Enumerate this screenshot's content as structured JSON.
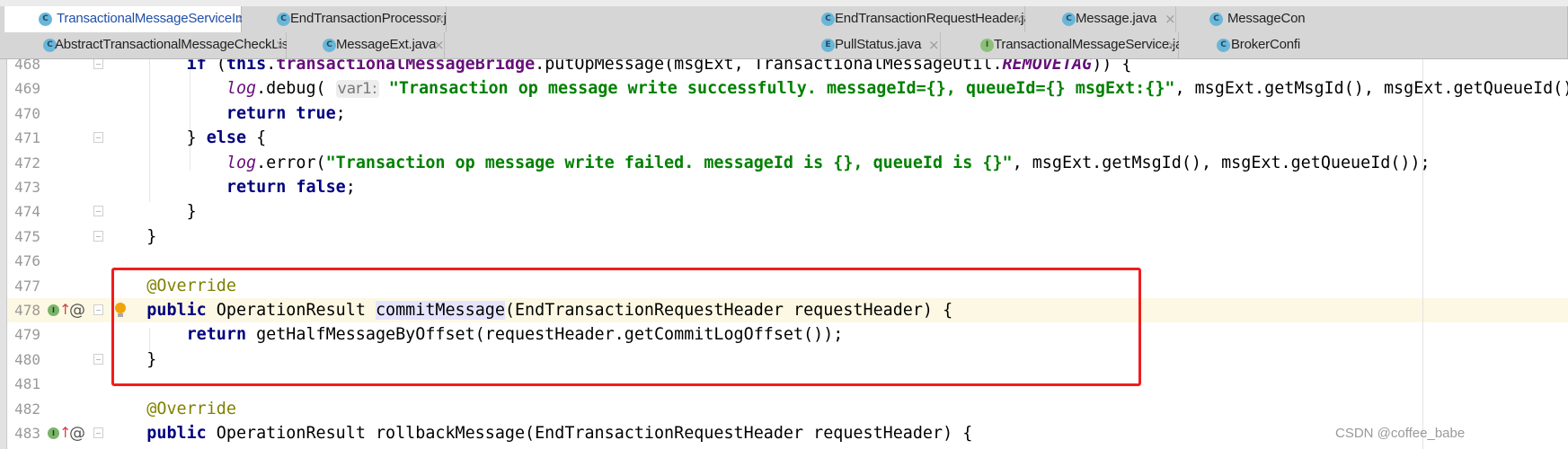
{
  "tabs_row1": [
    {
      "label": "TransactionalMessageServiceImpl.java",
      "icon": "C",
      "active": true
    },
    {
      "label": "EndTransactionProcessor.java",
      "icon": "C"
    },
    {
      "label": "EndTransactionRequestHeader.java",
      "icon": "C"
    },
    {
      "label": "Message.java",
      "icon": "C"
    },
    {
      "label": "MessageCon",
      "icon": "C"
    }
  ],
  "tabs_row2": [
    {
      "label": "AbstractTransactionalMessageCheckListener.java",
      "icon": "C"
    },
    {
      "label": "MessageExt.java",
      "icon": "C"
    },
    {
      "label": "PullStatus.java",
      "icon": "E"
    },
    {
      "label": "TransactionalMessageService.java",
      "icon": "I"
    },
    {
      "label": "BrokerConfi",
      "icon": "C"
    }
  ],
  "close_glyph": "×",
  "lines": [
    {
      "n": "468",
      "tokens": [
        [
          "        ",
          ""
        ],
        [
          "if",
          "kw"
        ],
        [
          " (",
          ""
        ],
        [
          "this",
          "kw"
        ],
        [
          ".",
          ""
        ],
        [
          "transactionalMessageBridge",
          "fld"
        ],
        [
          ".putOpMessage(msgExt, TransactionalMessageUtil.",
          ""
        ],
        [
          "REMOVETAG",
          "sfb"
        ],
        [
          ")) {",
          ""
        ]
      ]
    },
    {
      "n": "469",
      "tokens": [
        [
          "            ",
          ""
        ],
        [
          "log",
          "sf"
        ],
        [
          ".debug( ",
          ""
        ],
        [
          "var1:",
          "hint"
        ],
        [
          " ",
          ""
        ],
        [
          "\"Transaction op message write successfully. messageId={}, queueId={} msgExt:{}\"",
          "str"
        ],
        [
          ", msgExt.getMsgId(), msgExt.getQueueId(), msgExt);",
          ""
        ]
      ]
    },
    {
      "n": "470",
      "tokens": [
        [
          "            ",
          ""
        ],
        [
          "return true",
          "kw"
        ],
        [
          ";",
          ""
        ]
      ]
    },
    {
      "n": "471",
      "tokens": [
        [
          "        } ",
          ""
        ],
        [
          "else",
          "kw"
        ],
        [
          " {",
          ""
        ]
      ]
    },
    {
      "n": "472",
      "tokens": [
        [
          "            ",
          ""
        ],
        [
          "log",
          "sf"
        ],
        [
          ".error(",
          ""
        ],
        [
          "\"Transaction op message write failed. messageId is {}, queueId is {}\"",
          "str"
        ],
        [
          ", msgExt.getMsgId(), msgExt.getQueueId());",
          ""
        ]
      ]
    },
    {
      "n": "473",
      "tokens": [
        [
          "            ",
          ""
        ],
        [
          "return false",
          "kw"
        ],
        [
          ";",
          ""
        ]
      ]
    },
    {
      "n": "474",
      "tokens": [
        [
          "        }",
          ""
        ]
      ]
    },
    {
      "n": "475",
      "tokens": [
        [
          "    }",
          ""
        ]
      ]
    },
    {
      "n": "476",
      "tokens": []
    },
    {
      "n": "477",
      "tokens": [
        [
          "    ",
          ""
        ],
        [
          "@Override",
          "ann"
        ]
      ]
    },
    {
      "n": "478",
      "tokens": [
        [
          "    ",
          ""
        ],
        [
          "public",
          "kw"
        ],
        [
          " OperationResult ",
          ""
        ],
        [
          "commitMessage",
          "hl"
        ],
        [
          "(EndTransactionRequestHeader requestHeader) {",
          ""
        ]
      ]
    },
    {
      "n": "479",
      "tokens": [
        [
          "        ",
          ""
        ],
        [
          "return",
          "kw"
        ],
        [
          " getHalfMessageByOffset(requestHeader.getCommitLogOffset());",
          ""
        ]
      ]
    },
    {
      "n": "480",
      "tokens": [
        [
          "    }",
          ""
        ]
      ]
    },
    {
      "n": "481",
      "tokens": []
    },
    {
      "n": "482",
      "tokens": [
        [
          "    ",
          ""
        ],
        [
          "@Override",
          "ann"
        ]
      ]
    },
    {
      "n": "483",
      "tokens": [
        [
          "    ",
          ""
        ],
        [
          "public",
          "kw"
        ],
        [
          " OperationResult rollbackMessage(EndTransactionRequestHeader requestHeader) {",
          ""
        ]
      ]
    }
  ],
  "current_line": "478",
  "fold_lines": [
    "468",
    "471",
    "474",
    "475",
    "478",
    "480",
    "483"
  ],
  "implements_lines": [
    "478",
    "483"
  ],
  "gutter_icons": {
    "implements": "I",
    "override_arrow": "↑",
    "annotation": "@"
  },
  "watermark": "CSDN @coffee_babe",
  "colors": {
    "highlight_box": "#f01d1d",
    "current_line": "#fdf8e3",
    "keyword": "#000080",
    "string": "#008000",
    "annotation": "#808000"
  }
}
